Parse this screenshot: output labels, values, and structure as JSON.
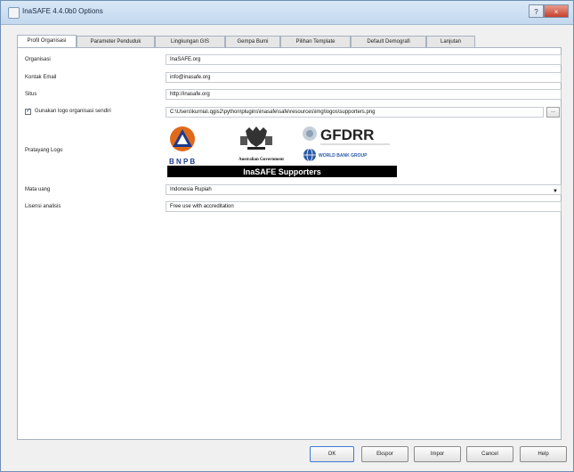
{
  "window": {
    "title": "InaSAFE 4.4.0b0 Options",
    "help_glyph": "?",
    "close_glyph": "×"
  },
  "tabs": [
    {
      "label": "Profil Organisasi",
      "active": true
    },
    {
      "label": "Parameter Penduduk",
      "active": false
    },
    {
      "label": "Lingkungan GIS",
      "active": false
    },
    {
      "label": "Gempa Bumi",
      "active": false
    },
    {
      "label": "Pilihan Template",
      "active": false
    },
    {
      "label": "Default Demografi",
      "active": false
    },
    {
      "label": "Lanjutan",
      "active": false
    }
  ],
  "form": {
    "organisation_label": "Organisasi",
    "organisation_value": "InaSAFE.org",
    "email_label": "Kontak Email",
    "email_value": "info@inasafe.org",
    "site_label": "Situs",
    "site_value": "http://inasafe.org",
    "custom_logo_label": "Gunakan logo organisasi sendiri",
    "custom_logo_checked": true,
    "custom_logo_path": "C:\\Users\\kurnia\\.qgis2\\python\\plugins\\inasafe\\safe\\resources\\img\\logos\\supporters.png",
    "browse_label": "...",
    "logo_preview_label": "Pratayang Logo",
    "currency_label": "Mata uang",
    "currency_value": "Indonesia Rupiah",
    "license_label": "Lisensi analisis",
    "license_value": "Free use with accreditation"
  },
  "logo": {
    "bnpb_text": "B N P B",
    "australia_text": "Australian Government",
    "gfdrr_text": "GFDRR",
    "worldbank_text": "WORLD BANK GROUP",
    "supporters_text": "InaSAFE Supporters"
  },
  "buttons": {
    "ok": "OK",
    "export": "Ekspor",
    "import": "Impor",
    "cancel": "Cancel",
    "help": "Help"
  },
  "colors": {
    "bnpb_orange": "#e06a1a",
    "bnpb_blue": "#1b3a8c",
    "worldbank_blue": "#2b5aa8",
    "supporters_bar": "#000000"
  }
}
